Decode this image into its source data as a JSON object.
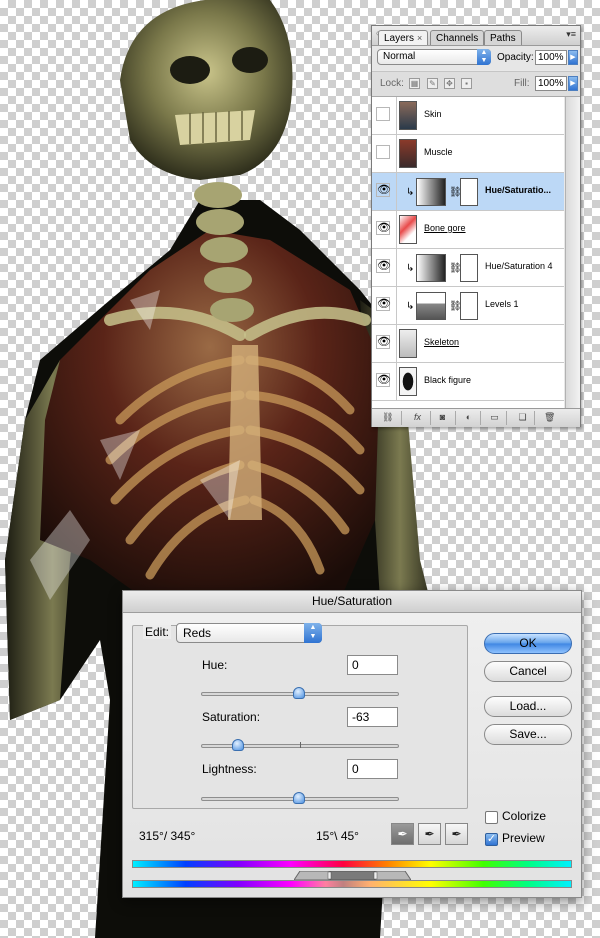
{
  "layers_panel": {
    "tabs": [
      {
        "label": "Layers",
        "close": "×",
        "active": true
      },
      {
        "label": "Channels",
        "active": false
      },
      {
        "label": "Paths",
        "active": false
      }
    ],
    "blend_mode": "Normal",
    "opacity_label": "Opacity:",
    "opacity_value": "100%",
    "lock_label": "Lock:",
    "fill_label": "Fill:",
    "fill_value": "100%",
    "layers": [
      {
        "name": "Skin",
        "visible": false,
        "type": "pixel",
        "selected": false
      },
      {
        "name": "Muscle",
        "visible": false,
        "type": "pixel",
        "selected": false
      },
      {
        "name": "Hue/Saturatio...",
        "visible": true,
        "type": "adjustment",
        "clipped": true,
        "selected": true
      },
      {
        "name": "Bone gore",
        "visible": true,
        "type": "pixel",
        "selected": false
      },
      {
        "name": "Hue/Saturation 4",
        "visible": true,
        "type": "adjustment",
        "clipped": true,
        "selected": false
      },
      {
        "name": "Levels 1",
        "visible": true,
        "type": "adjustment",
        "clipped": true,
        "selected": false
      },
      {
        "name": "Skeleton",
        "visible": true,
        "type": "pixel",
        "selected": false
      },
      {
        "name": "Black figure",
        "visible": true,
        "type": "pixel",
        "selected": false
      }
    ]
  },
  "dialog": {
    "title": "Hue/Saturation",
    "edit_label": "Edit:",
    "edit_value": "Reds",
    "hue_label": "Hue:",
    "hue_value": "0",
    "saturation_label": "Saturation:",
    "saturation_value": "-63",
    "lightness_label": "Lightness:",
    "lightness_value": "0",
    "ok_label": "OK",
    "cancel_label": "Cancel",
    "load_label": "Load...",
    "save_label": "Save...",
    "colorize_label": "Colorize",
    "colorize_checked": false,
    "preview_label": "Preview",
    "preview_checked": true,
    "range_left": "315°/ 345°",
    "range_right": "15°\\ 45°"
  },
  "colors": {
    "selection": "#bcd8f6",
    "accent": "#2f73d2"
  }
}
